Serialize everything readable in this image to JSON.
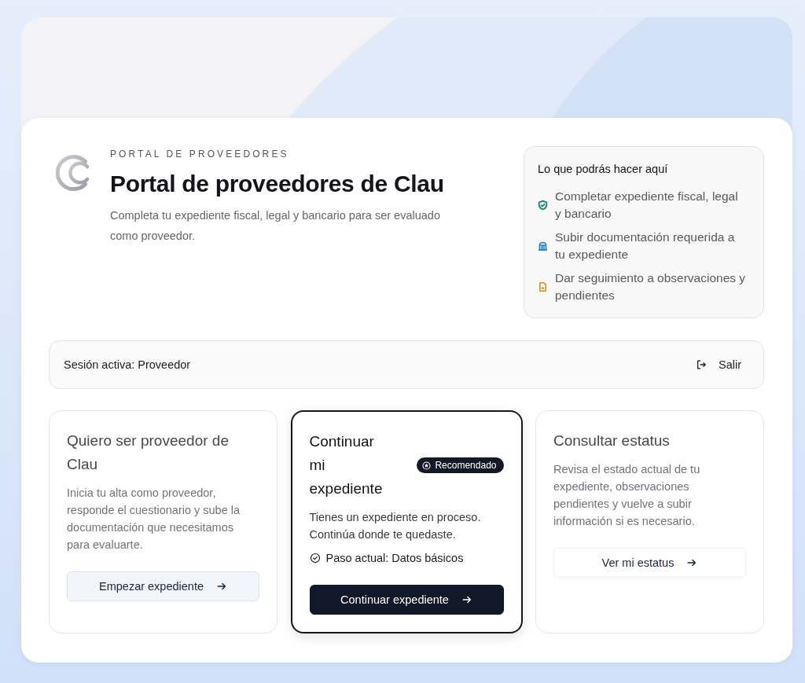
{
  "portal": {
    "eyebrow": "PORTAL DE PROVEEDORES",
    "title": "Portal de proveedores de Clau",
    "subtitle": "Completa tu expediente fiscal, legal y bancario para ser evaluado como proveedor."
  },
  "capabilities": {
    "title": "Lo que podrás hacer aquí",
    "items": [
      {
        "text": "Completar expediente fiscal, legal y bancario",
        "color": "#1f8a70"
      },
      {
        "text": "Subir documentación requerida a tu expediente",
        "color": "#3b87c4"
      },
      {
        "text": "Dar seguimiento a observaciones y pendientes",
        "color": "#d4902f"
      }
    ]
  },
  "session": {
    "label": "Sesión activa: Proveedor",
    "logout": "Salir"
  },
  "cards": [
    {
      "title": "Quiero ser proveedor de Clau",
      "description": "Inicia tu alta como proveedor, responde el cuestionario y sube la documentación que necesitamos para evaluarte.",
      "selected": false,
      "button": {
        "label": "Empezar expediente",
        "kind": "secondary"
      }
    },
    {
      "title": "Continuar mi expediente",
      "badge": "Recomendado",
      "description": "Tienes un expediente en proceso. Continúa donde te quedaste.",
      "step": "Paso actual: Datos básicos",
      "selected": true,
      "button": {
        "label": "Continuar expediente",
        "kind": "primary"
      }
    },
    {
      "title": "Consultar estatus",
      "description": "Revisa el estado actual de tu expediente, observaciones pendientes y vuelve a subir información si es necesario.",
      "selected": false,
      "button": {
        "label": "Ver mi estatus",
        "kind": "ghost"
      }
    }
  ]
}
